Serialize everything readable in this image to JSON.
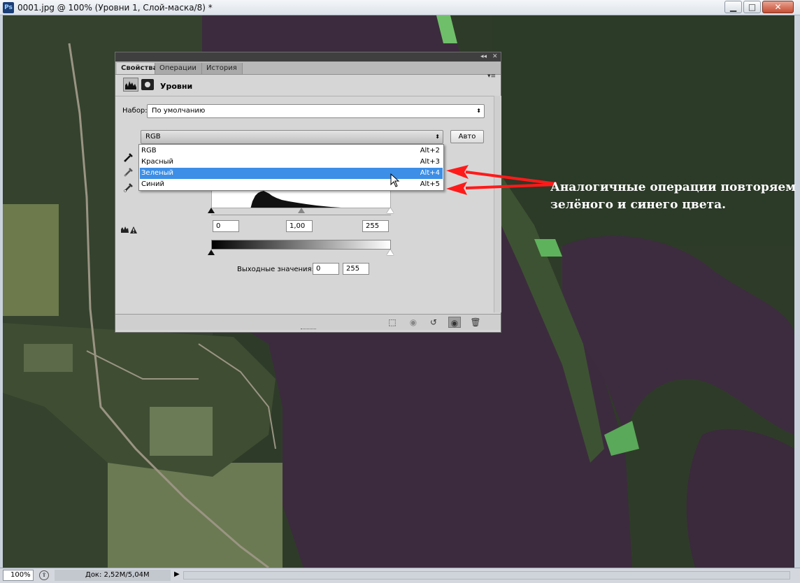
{
  "window": {
    "app_icon": "Ps",
    "title": "0001.jpg @ 100% (Уровни 1, Слой-маска/8) *",
    "min_label": "▁",
    "max_label": "□",
    "close_label": "✕"
  },
  "panel": {
    "tabs": [
      {
        "label": "Свойства",
        "active": true
      },
      {
        "label": "Операции",
        "active": false
      },
      {
        "label": "История",
        "active": false
      }
    ],
    "heading": "Уровни",
    "preset_label": "Набор:",
    "preset_value": "По умолчанию",
    "channel_value": "RGB",
    "auto_label": "Авто",
    "input_levels": {
      "black": "0",
      "gamma": "1,00",
      "white": "255"
    },
    "output_label": "Выходные значения:",
    "output_levels": {
      "black": "0",
      "white": "255"
    },
    "icons": [
      "levels-adjustment-icon",
      "layer-mask-icon",
      "eyedropper-black-icon",
      "eyedropper-gray-icon",
      "eyedropper-white-icon",
      "clipping-warning-icon",
      "clip-to-layer-icon",
      "view-previous-icon",
      "reset-icon",
      "visibility-eye-icon",
      "trash-icon"
    ]
  },
  "channel_menu": {
    "items": [
      {
        "label": "RGB",
        "shortcut": "Alt+2",
        "selected": false
      },
      {
        "label": "Красный",
        "shortcut": "Alt+3",
        "selected": false
      },
      {
        "label": "Зеленый",
        "shortcut": "Alt+4",
        "selected": true
      },
      {
        "label": "Синий",
        "shortcut": "Alt+5",
        "selected": false
      }
    ]
  },
  "annotation": {
    "line1": "Аналогичные операции повторяем для",
    "line2": "зелёного и синего цвета.",
    "color": "#ff1a1a"
  },
  "status": {
    "zoom": "100%",
    "doc_info": "Док: 2,52M/5,04M"
  },
  "colors": {
    "selection": "#3c8ee6",
    "panel_bg": "#d6d6d6",
    "arrow": "#ff1a1a"
  }
}
